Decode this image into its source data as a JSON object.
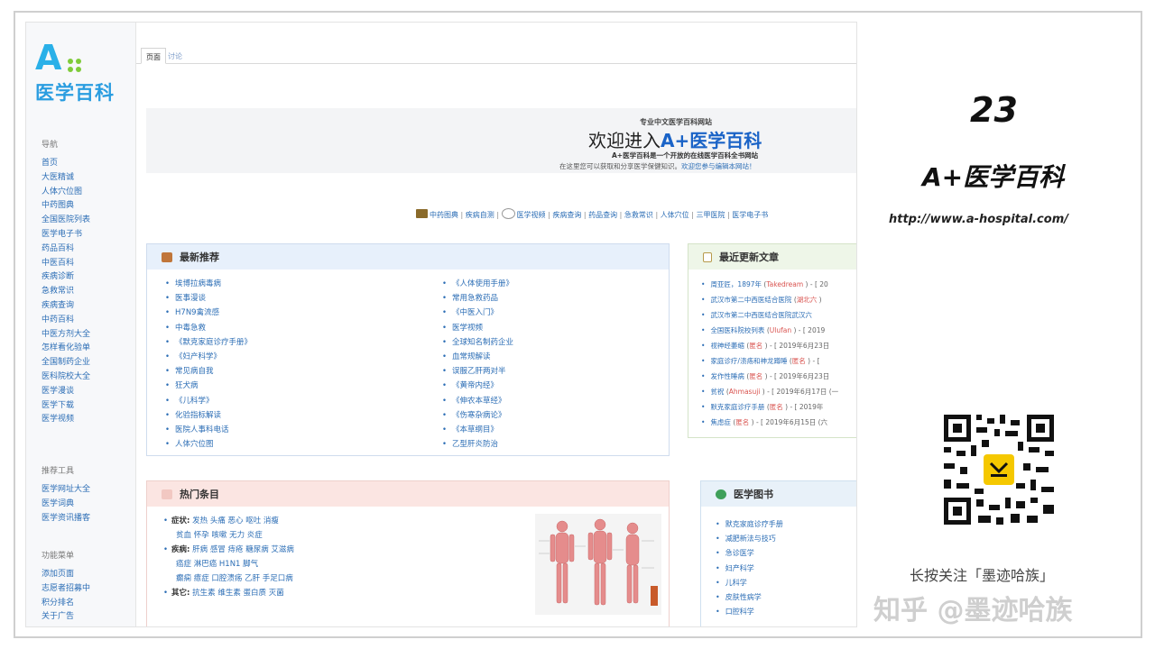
{
  "sidebar": {
    "logo_letter": "A",
    "logo_name": "医学百科",
    "nav_title": "导航",
    "nav_items": [
      "首页",
      "大医精诚",
      "人体穴位图",
      "中药图典",
      "全国医院列表",
      "医学电子书",
      "药品百科",
      "中医百科",
      "疾病诊断",
      "急救常识",
      "疾病查询",
      "中药百科",
      "中医方剂大全",
      "怎样看化验单",
      "全国制药企业",
      "医科院校大全",
      "医学漫谈",
      "医学下载",
      "医学视频"
    ],
    "tools_title": "推荐工具",
    "tools_items": [
      "医学网址大全",
      "医学词典",
      "医学资讯播客"
    ],
    "func_title": "功能菜单",
    "func_items": [
      "添加页面",
      "志愿者招募中",
      "积分排名",
      "关于广告"
    ]
  },
  "tabs": {
    "page": "页面",
    "discussion": "讨论"
  },
  "banner": {
    "subtitle": "专业中文医学百科网站",
    "title_prefix": "欢迎进入",
    "title_accent": "A+医学百科",
    "line1": "A+医学百科是一个开放的在线医学百科全书网站",
    "line2_a": "在这里您可以获取和分享医学保健知识。",
    "line2_b": "欢迎您参与编辑本网站！"
  },
  "quicklinks": [
    "中药图典",
    "疾病自测",
    "医学视频",
    "疾病查询",
    "药品查询",
    "急救常识",
    "人体穴位",
    "三甲医院",
    "医学电子书"
  ],
  "latest": {
    "title": "最新推荐",
    "col1": [
      "埃博拉病毒病",
      "医事漫谈",
      "H7N9禽流感",
      "中毒急救",
      "《默克家庭诊疗手册》",
      "《妇产科学》",
      "常见病自我",
      "狂犬病",
      "《儿科学》",
      "化验指标解读",
      "医院人事科电话",
      "人体穴位图"
    ],
    "col2": [
      "《人体使用手册》",
      "常用急救药品",
      "《中医入门》",
      "医学视频",
      "全球知名制药企业",
      "血常规解读",
      "误服乙肝两对半",
      "《黄帝内经》",
      "《伸农本草经》",
      "《伤寒杂病论》",
      "《本草纲目》",
      "乙型肝炎防治"
    ]
  },
  "updates": {
    "title": "最近更新文章",
    "items": [
      {
        "text": "周亚匠，1897年",
        "user": "Takedream",
        "tail": " - [ 20"
      },
      {
        "text": "武汉市第二中西医结合医院",
        "user": "湖北六",
        "tail": ""
      },
      {
        "text": "武汉市第二中西医结合医院武汉六",
        "user": "",
        "tail": ""
      },
      {
        "text": "全国医科院校列表",
        "user": "Ulufan",
        "tail": " - [ 2019"
      },
      {
        "text": "视神经萎缩",
        "user": "匿名",
        "tail": " - [ 2019年6月23日"
      },
      {
        "text": "家庭诊疗/溃疡和神龙蹲睡",
        "user": "匿名",
        "tail": " - [ "
      },
      {
        "text": "发作性睡病",
        "user": "匿名",
        "tail": " - [ 2019年6月23日"
      },
      {
        "text": "贫祝",
        "user": "Ahmasuji",
        "tail": " - [ 2019年6月17日 (一"
      },
      {
        "text": "默克家庭诊疗手册",
        "user": "匿名",
        "tail": " - [ 2019年"
      },
      {
        "text": "焦虑症",
        "user": "匿名",
        "tail": " - [ 2019年6月15日 (六"
      }
    ]
  },
  "hot": {
    "title": "热门条目",
    "symptom_label": "症状:",
    "symptom_a": "发热 头痛 恶心 呕吐 消瘦",
    "symptom_b": "贫血 怀孕 咳嗽 无力 炎症",
    "disease_label": "疾病:",
    "disease_a": "肝病 感冒 痔疮 糖尿病 艾滋病",
    "disease_b": "癌症 淋巴癌 H1N1 脚气",
    "disease_c": "癫痫 癔症 口腔溃疡 乙肝 手足口病",
    "other_label": "其它:",
    "other_a": "抗生素 维生素 蛋白质 灭菌"
  },
  "books": {
    "title": "医学图书",
    "items": [
      "默克家庭诊疗手册",
      "减肥新法与技巧",
      "急诊医学",
      "妇产科学",
      "儿科学",
      "皮肤性病学",
      "口腔科学"
    ]
  },
  "info": {
    "number": "23",
    "brand": "A+医学百科",
    "url": "http://www.a-hospital.com/",
    "follow": "长按关注「墨迹哈族」",
    "watermark": "知乎 @墨迹哈族"
  },
  "colors": {
    "brand_blue": "#2ab0e8",
    "link": "#2b6db5",
    "accent_green": "#7fcb3a"
  }
}
